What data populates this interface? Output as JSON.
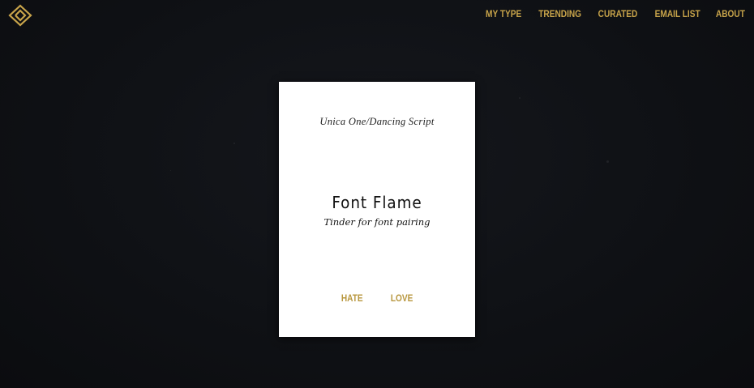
{
  "colors": {
    "background": "#0f1115",
    "accent": "#c8a44a",
    "card": "#ffffff"
  },
  "header": {
    "logo_icon": "diamond-heart-icon",
    "nav": [
      {
        "label": "MY TYPE"
      },
      {
        "label": "TRENDING"
      },
      {
        "label": "CURATED"
      },
      {
        "label": "EMAIL LIST"
      },
      {
        "label": "ABOUT"
      }
    ]
  },
  "card": {
    "font_pair": "Unica One/Dancing Script",
    "title": "Font Flame",
    "subtitle": "Tinder for font pairing",
    "actions": {
      "hate_label": "HATE",
      "love_label": "LOVE"
    }
  }
}
